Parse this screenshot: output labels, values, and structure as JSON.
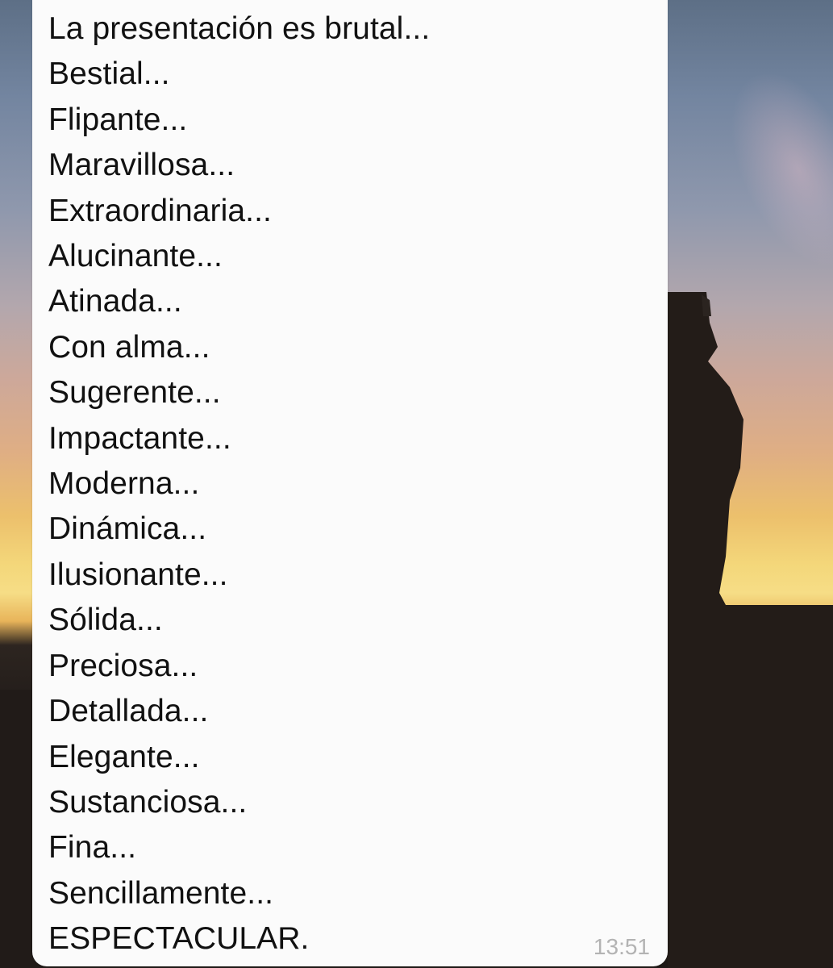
{
  "message": {
    "lines": [
      "La presentación es brutal...",
      "Bestial...",
      "Flipante...",
      "Maravillosa...",
      "Extraordinaria...",
      "Alucinante...",
      "Atinada...",
      "Con alma...",
      "Sugerente...",
      "Impactante...",
      "Moderna...",
      "Dinámica...",
      "Ilusionante...",
      "Sólida...",
      "Preciosa...",
      "Detallada...",
      "Elegante...",
      "Sustanciosa...",
      "Fina...",
      "Sencillamente...",
      "ESPECTACULAR."
    ],
    "timestamp": "13:51"
  },
  "colors": {
    "bubble_background": "#fbfbfb",
    "text": "#111111",
    "timestamp": "#b3b3b3"
  }
}
